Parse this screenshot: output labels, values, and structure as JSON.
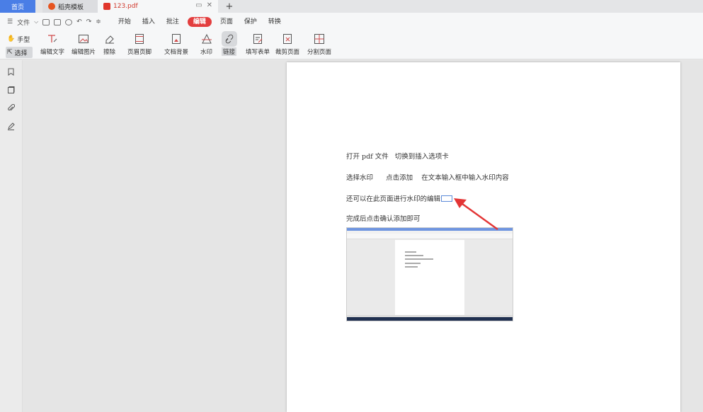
{
  "tabs": {
    "home": "首页",
    "template": "稻壳模板",
    "file": "123.pdf",
    "add": "+"
  },
  "menu": {
    "file": "文件",
    "items": [
      "开始",
      "插入",
      "批注",
      "编辑",
      "页面",
      "保护",
      "转换"
    ],
    "active": "编辑"
  },
  "ribbon": {
    "hand": "手型",
    "select": "选择",
    "tools": [
      "编辑文字",
      "编辑图片",
      "擦除",
      "页眉页脚",
      "文档背景",
      "水印",
      "链接",
      "填写表单",
      "裁剪页面",
      "分割页面"
    ]
  },
  "document": {
    "lines": [
      "打开 pdf 文件   切换到插入选项卡",
      "选择水印      点击添加    在文本输入框中输入水印内容",
      "还可以在此页面进行水印的编辑",
      "完成后点击确认添加即可"
    ]
  },
  "colors": {
    "accent": "#4a7ee6",
    "active_menu": "#e33e3e",
    "arrow": "#e33535"
  },
  "icons": {
    "sidebar": [
      "bookmark-icon",
      "thumbnail-icon",
      "attachment-icon",
      "signature-icon"
    ]
  }
}
